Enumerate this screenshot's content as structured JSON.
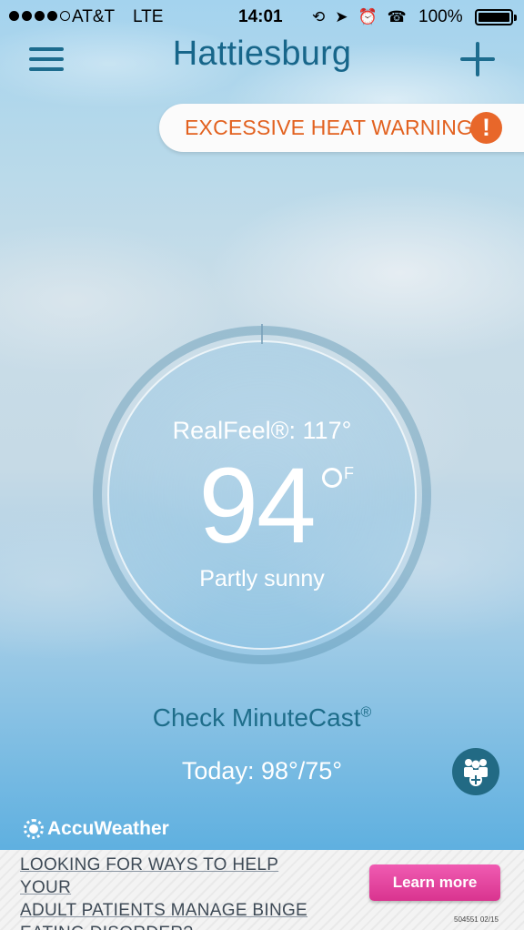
{
  "status_bar": {
    "carrier": "AT&T",
    "network": "LTE",
    "time": "14:01",
    "battery": "100%",
    "icons": [
      "orientation-lock-icon",
      "location-arrow-icon",
      "alarm-icon",
      "tty-icon"
    ],
    "signal_bars_filled": 4,
    "signal_bars_total": 5
  },
  "header": {
    "city": "Hattiesburg"
  },
  "alert": {
    "label": "EXCESSIVE HEAT WARNING",
    "icon_glyph": "!",
    "color": "#e2611f"
  },
  "current": {
    "realfeel": "RealFeel®: 117°",
    "temperature": "94",
    "unit": "F",
    "condition": "Partly sunny"
  },
  "minutecast": {
    "label": "Check MinuteCast",
    "mark": "®"
  },
  "today": "Today: 98°/75°",
  "brand": "AccuWeather",
  "ad": {
    "line1": "LOOKING FOR WAYS TO HELP YOUR",
    "line2": "ADULT PATIENTS MANAGE BINGE",
    "line3": "EATING DISORDER?",
    "button": "Learn more",
    "code": "504551 02/15"
  },
  "colors": {
    "header_text": "#17668a",
    "alert_orange": "#e8672a",
    "ad_button": "#e0439e"
  }
}
